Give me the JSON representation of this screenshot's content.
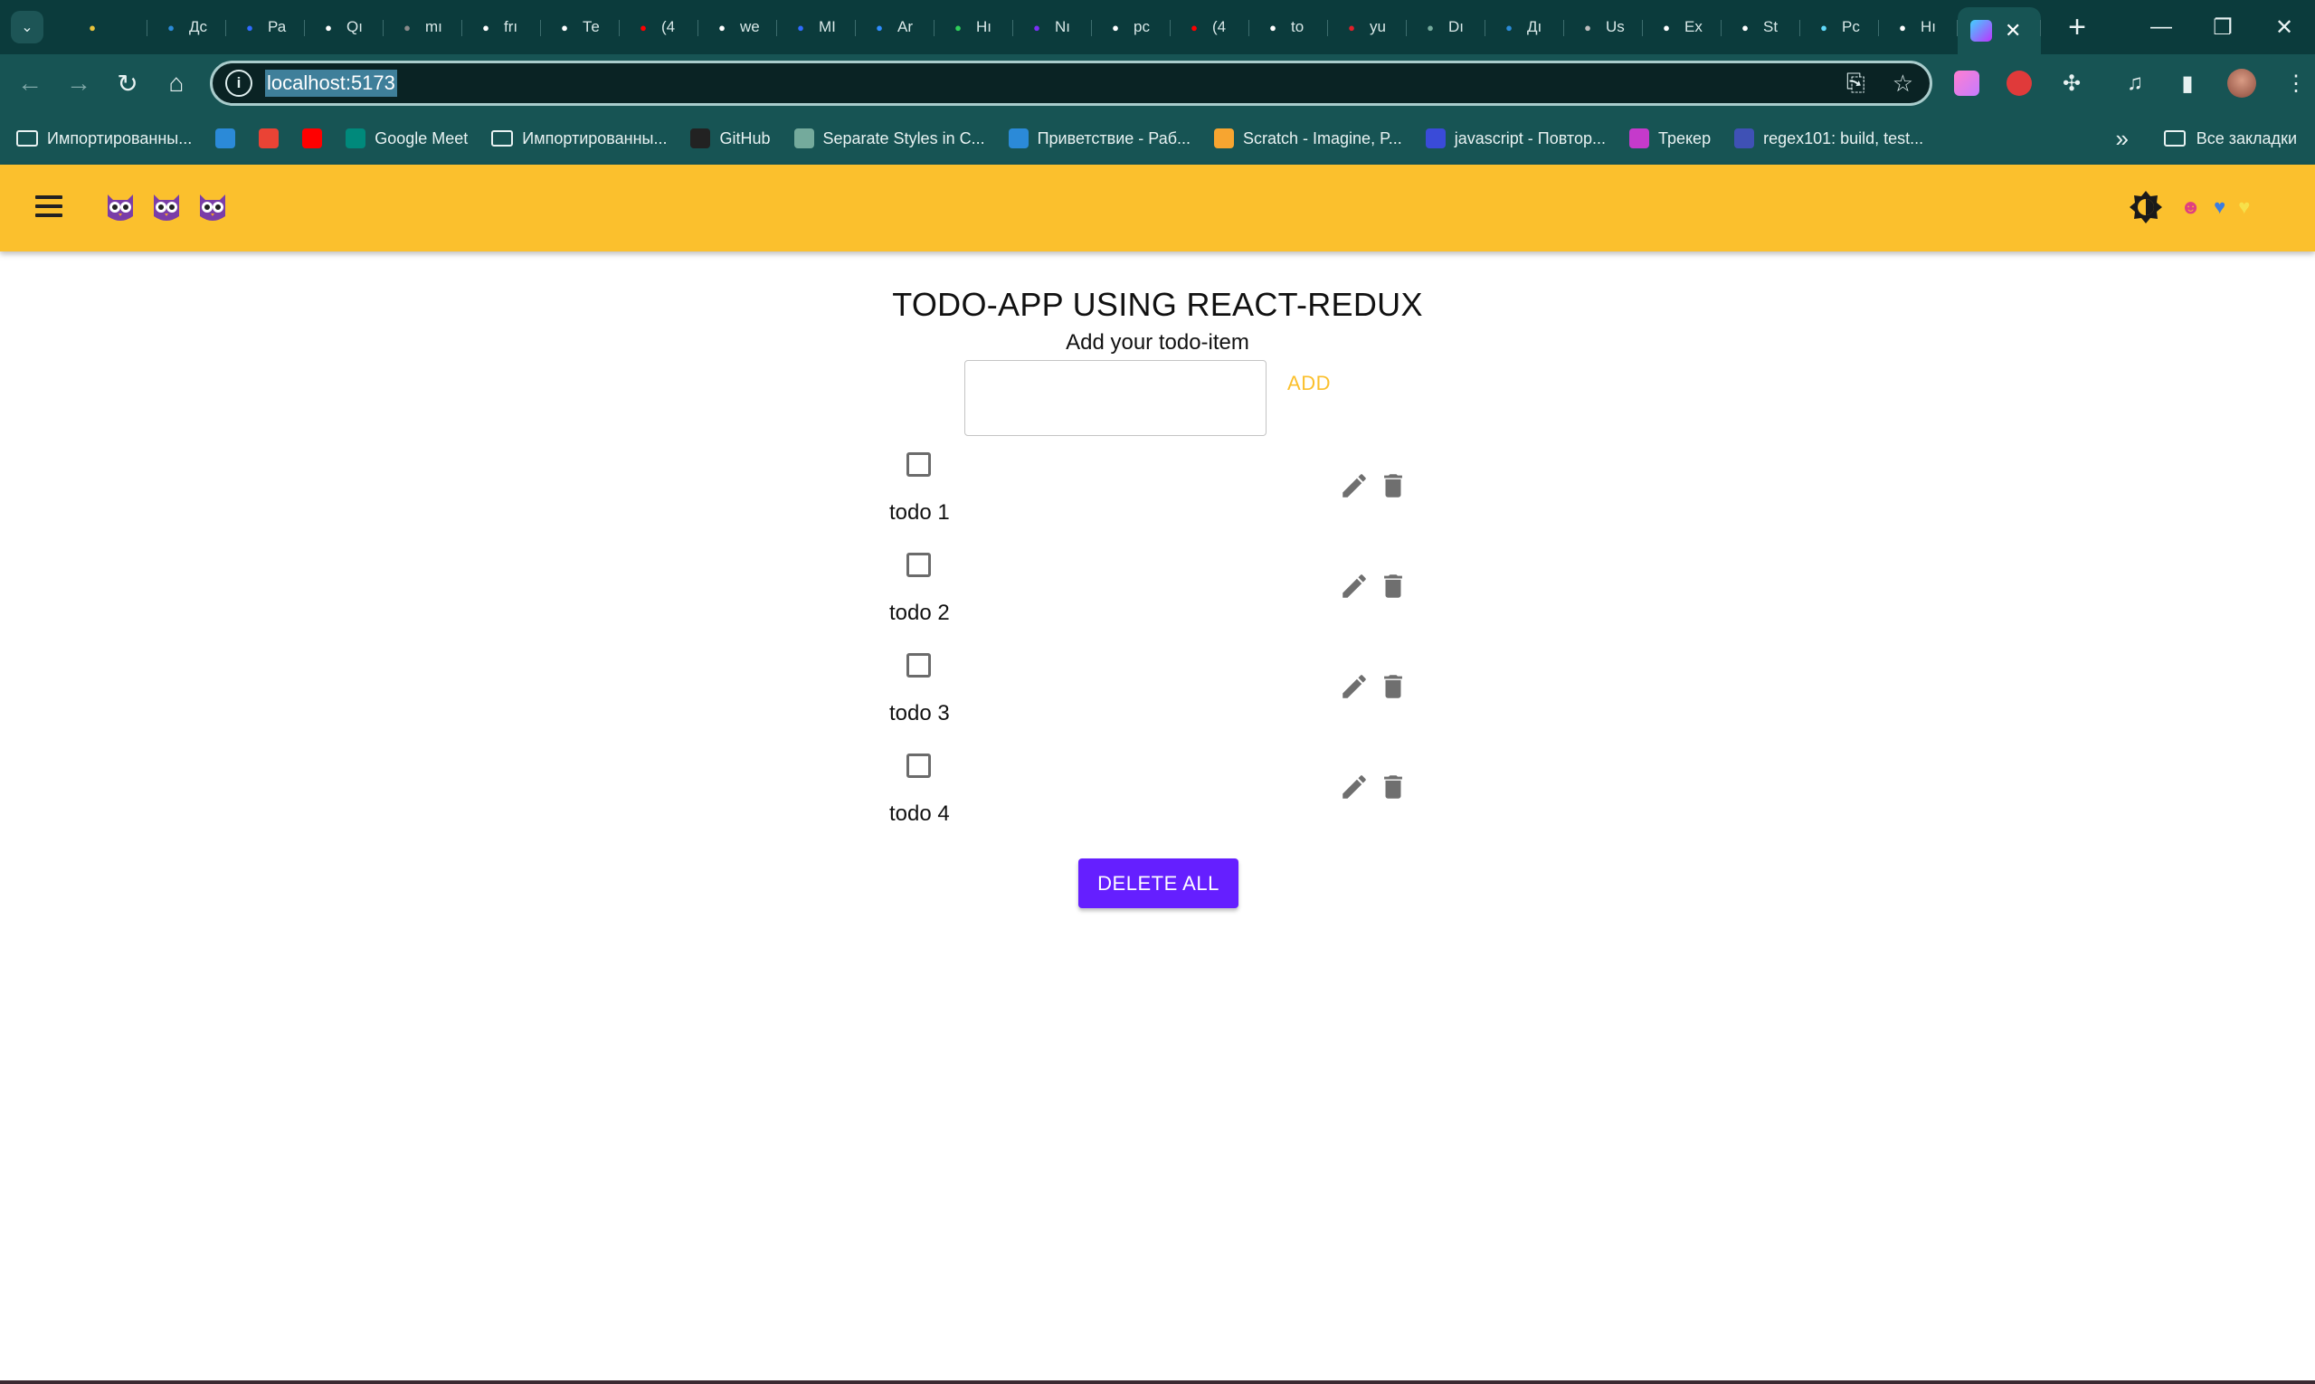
{
  "browser": {
    "tabs": [
      {
        "title": "",
        "icon": "js-icon",
        "color": "#e8c43c"
      },
      {
        "title": "Дс",
        "icon": "vscode-icon",
        "color": "#2b8ad8"
      },
      {
        "title": "Ра",
        "icon": "mui-icon",
        "color": "#2f6bff"
      },
      {
        "title": "Qı",
        "icon": "github-icon",
        "color": "#ffffff"
      },
      {
        "title": "mı",
        "icon": "mock-api-icon",
        "color": "#8a8a8a"
      },
      {
        "title": "frı",
        "icon": "github-icon",
        "color": "#ffffff"
      },
      {
        "title": "Те",
        "icon": "github-icon",
        "color": "#ffffff"
      },
      {
        "title": "(4",
        "icon": "youtube-icon",
        "color": "#ff0000"
      },
      {
        "title": "we",
        "icon": "github-icon",
        "color": "#ffffff"
      },
      {
        "title": "MI",
        "icon": "mui-icon",
        "color": "#2f6bff"
      },
      {
        "title": "Ar",
        "icon": "diamond-icon",
        "color": "#2f8cff"
      },
      {
        "title": "Hı",
        "icon": "clover-icon",
        "color": "#2fd05a"
      },
      {
        "title": "Nı",
        "icon": "bootstrap-icon",
        "color": "#7b2ff7"
      },
      {
        "title": "pc",
        "icon": "github-icon",
        "color": "#ffffff"
      },
      {
        "title": "(4",
        "icon": "youtube-icon",
        "color": "#ff0000"
      },
      {
        "title": "to",
        "icon": "github-icon",
        "color": "#ffffff"
      },
      {
        "title": "yu",
        "icon": "yandex-icon",
        "color": "#e0202a"
      },
      {
        "title": "Dı",
        "icon": "chatgpt-icon",
        "color": "#74aa9c"
      },
      {
        "title": "Дı",
        "icon": "vscode-icon",
        "color": "#2b8ad8"
      },
      {
        "title": "Us",
        "icon": "globe-icon",
        "color": "#bdbdbd"
      },
      {
        "title": "Ex",
        "icon": "express-icon",
        "color": "#ffffff"
      },
      {
        "title": "St",
        "icon": "codepen-icon",
        "color": "#ffffff"
      },
      {
        "title": "Pc",
        "icon": "react-icon",
        "color": "#61dafb"
      },
      {
        "title": "Hı",
        "icon": "chrome-icon",
        "color": "#ffffff"
      }
    ],
    "url": "localhost:5173",
    "bookmarks": [
      {
        "label": "Импортированны...",
        "type": "folder"
      },
      {
        "label": "",
        "type": "vscode",
        "color": "#2b8ad8"
      },
      {
        "label": "",
        "type": "gmail",
        "color": "#ea4335"
      },
      {
        "label": "",
        "type": "youtube",
        "color": "#ff0000"
      },
      {
        "label": "Google Meet",
        "type": "meet",
        "color": "#00897b"
      },
      {
        "label": "Импортированны...",
        "type": "folder"
      },
      {
        "label": "GitHub",
        "type": "github",
        "color": "#222222"
      },
      {
        "label": "Separate Styles in C...",
        "type": "chatgpt",
        "color": "#74aa9c"
      },
      {
        "label": "Приветствие - Раб...",
        "type": "vscode",
        "color": "#2b8ad8"
      },
      {
        "label": "Scratch - Imagine, P...",
        "type": "scratch",
        "color": "#f7a530"
      },
      {
        "label": "javascript - Повтор...",
        "type": "stackoverflow",
        "color": "#3a4bd8"
      },
      {
        "label": "Трекер",
        "type": "tracker",
        "color": "#c53acb"
      },
      {
        "label": "regex101: build, test...",
        "type": "regex",
        "color": "#3f51b5"
      }
    ],
    "all_bookmarks_label": "Все закладки"
  },
  "app": {
    "title": "TODO-APP USING REACT-REDUX",
    "subtitle": "Add your todo-item",
    "input_value": "",
    "add_label": "ADD",
    "todos": [
      {
        "text": "todo 1",
        "checked": false
      },
      {
        "text": "todo 2",
        "checked": false
      },
      {
        "text": "todo 3",
        "checked": false
      },
      {
        "text": "todo 4",
        "checked": false
      }
    ],
    "delete_all_label": "DELETE ALL"
  },
  "colors": {
    "appbar": "#fbc02d",
    "add": "#fbc02d",
    "delete_all": "#651fff",
    "chrome": "#175454"
  }
}
